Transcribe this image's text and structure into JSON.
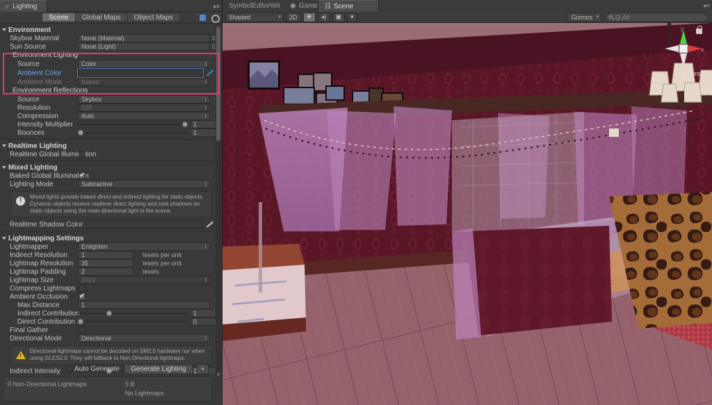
{
  "window": {
    "title": "Lighting",
    "tab_icon": "lighting-icon",
    "menu_icon": "panel-menu-icon"
  },
  "panel_toolbar": {
    "tabs": [
      {
        "label": "Scene",
        "active": true
      },
      {
        "label": "Global Maps",
        "active": false
      },
      {
        "label": "Object Maps",
        "active": false
      }
    ],
    "right_icons": [
      "lightmap-preview-icon",
      "gear-icon"
    ]
  },
  "sections": {
    "environment": {
      "header": "Environment",
      "skybox_material": {
        "label": "Skybox Material",
        "value": "None (Material)"
      },
      "sun_source": {
        "label": "Sun Source",
        "value": "None (Light)"
      },
      "environment_lighting": {
        "subheader": "Environment Lighting",
        "source": {
          "label": "Source",
          "value": "Color"
        },
        "ambient_color": {
          "label": "Ambient Color",
          "color": "#c79ace",
          "alpha": "#ffffff"
        },
        "ambient_mode": {
          "label": "Ambient Mode",
          "value": "Baked",
          "disabled": true
        }
      },
      "environment_reflections": {
        "subheader": "Environment Reflections",
        "source": {
          "label": "Source",
          "value": "Skybox"
        },
        "resolution": {
          "label": "Resolution",
          "value": "128"
        },
        "compression": {
          "label": "Compression",
          "value": "Auto"
        },
        "intensity_multiplier": {
          "label": "Intensity Multiplier",
          "value": "1",
          "slider_pct": 100
        },
        "bounces": {
          "label": "Bounces",
          "value": "1",
          "slider_pct": 0
        }
      }
    },
    "realtime_lighting": {
      "header": "Realtime Lighting",
      "realtime_gi": {
        "label": "Realtime Global Illumination",
        "checked": false
      }
    },
    "mixed_lighting": {
      "header": "Mixed Lighting",
      "baked_gi": {
        "label": "Baked Global Illumination",
        "checked": true
      },
      "lighting_mode": {
        "label": "Lighting Mode",
        "value": "Subtractive"
      },
      "info": "Mixed lights provide baked direct and indirect lighting for static objects. Dynamic objects receive realtime direct lighting and cast shadows on static objects using the main directional light in the scene.",
      "realtime_shadow_color": {
        "label": "Realtime Shadow Color",
        "color": "#6679ae",
        "alpha": "#ffffff"
      }
    },
    "lightmapping_settings": {
      "header": "Lightmapping Settings",
      "lightmapper": {
        "label": "Lightmapper",
        "value": "Enlighten"
      },
      "indirect_resolution": {
        "label": "Indirect Resolution",
        "value": "1",
        "unit": "texels per unit"
      },
      "lightmap_resolution": {
        "label": "Lightmap Resolution",
        "value": "35",
        "unit": "texels per unit"
      },
      "lightmap_padding": {
        "label": "Lightmap Padding",
        "value": "2",
        "unit": "texels"
      },
      "lightmap_size": {
        "label": "Lightmap Size",
        "value": "1024"
      },
      "compress_lightmaps": {
        "label": "Compress Lightmaps",
        "checked": false
      },
      "ambient_occlusion": {
        "label": "Ambient Occlusion",
        "checked": true
      },
      "max_distance": {
        "label": "Max Distance",
        "value": "1"
      },
      "indirect_contribution": {
        "label": "Indirect Contribution",
        "value": "1",
        "slider_pct": 27
      },
      "direct_contribution": {
        "label": "Direct Contribution",
        "value": "0",
        "slider_pct": 0
      },
      "final_gather": {
        "label": "Final Gather",
        "checked": false
      },
      "directional_mode": {
        "label": "Directional Mode",
        "value": "Directional"
      },
      "warning": "Directional lightmaps cannot be decoded on SM2.0 hardware nor when using GLES2.0. They will fallback to Non-Directional lightmaps.",
      "indirect_intensity": {
        "label": "Indirect Intensity",
        "value": "1",
        "slider_pct": 27
      }
    }
  },
  "footer": {
    "auto_generate": {
      "label": "Auto Generate",
      "checked": false
    },
    "generate_button": "Generate Lighting",
    "generate_dropdown": "▾",
    "status_left": "0 Non-Directional Lightmaps",
    "status_size": "0 B",
    "status_note": "No Lightmaps"
  },
  "scene_view": {
    "tabs": [
      {
        "label": "SymbolEditorWir",
        "icon": "",
        "active": false
      },
      {
        "label": "Game",
        "icon": "game-icon",
        "active": false
      },
      {
        "label": "Scene",
        "icon": "scene-icon",
        "active": true
      }
    ],
    "toolbar": {
      "draw_mode": "Shaded",
      "two_d": "2D",
      "lighting_toggle": "☀",
      "audio_toggle": "◂)",
      "effects_toggle": "▣",
      "effects_dropdown": "▾",
      "gizmos": "Gizmos",
      "search_placeholder": "Q·All"
    },
    "gizmo": {
      "axis_x": "x",
      "axis_y": "y",
      "projection": "Persp",
      "lock_icon": "lock-icon"
    }
  },
  "colors": {
    "highlight_box": "#f0317f",
    "ambient_swatch": "#c79ace",
    "shadow_swatch": "#6679ae",
    "panel_bg": "#393939",
    "accent_blue": "#6fa4e8"
  }
}
